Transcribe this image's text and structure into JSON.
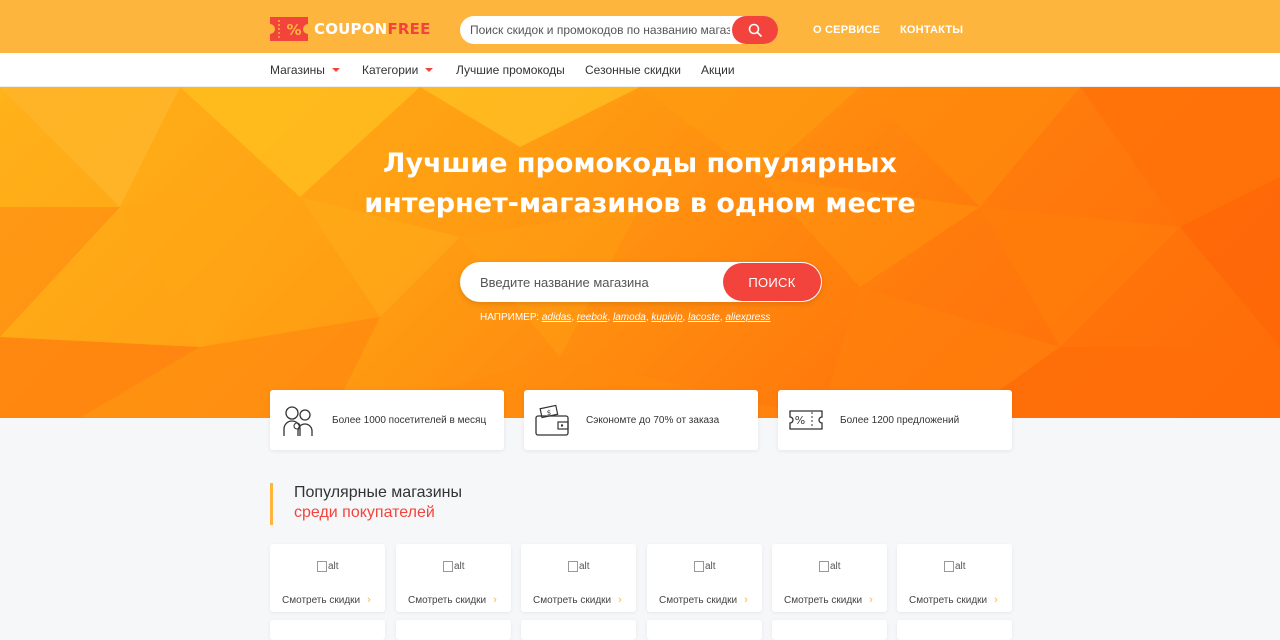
{
  "brand": {
    "part1": "COUPON",
    "part2": "FREE"
  },
  "top_search": {
    "placeholder": "Поиск скидок и промокодов по названию магазина",
    "icon": "search-icon"
  },
  "top_links": [
    "О СЕРВИСЕ",
    "КОНТАКТЫ"
  ],
  "nav": [
    {
      "label": "Магазины",
      "dropdown": true
    },
    {
      "label": "Категории",
      "dropdown": true
    },
    {
      "label": "Лучшие промокоды",
      "dropdown": false
    },
    {
      "label": "Сезонные скидки",
      "dropdown": false
    },
    {
      "label": "Акции",
      "dropdown": false
    }
  ],
  "hero": {
    "title_line1": "Лучшие промокоды популярных",
    "title_line2": "интернет-магазинов в одном месте",
    "search_placeholder": "Введите название магазина",
    "search_button": "ПОИСК",
    "examples_label": "НАПРИМЕР:",
    "examples": [
      "adidas",
      "reebok",
      "lamoda",
      "kupivip",
      "lacoste",
      "aliexpress"
    ]
  },
  "features": [
    {
      "icon": "visitors-icon",
      "text": "Более 1000 посетителей в месяц"
    },
    {
      "icon": "wallet-icon",
      "text": "Сэкономте до 70% от заказа"
    },
    {
      "icon": "coupon-icon",
      "text": "Более 1200 предложений"
    }
  ],
  "section": {
    "line1": "Популярные магазины",
    "line2": "среди покупателей"
  },
  "store_card": {
    "img_alt": "alt",
    "link_label": "Смотреть скидки"
  },
  "colors": {
    "accent_orange": "#fdb53d",
    "accent_red": "#f2443c"
  }
}
